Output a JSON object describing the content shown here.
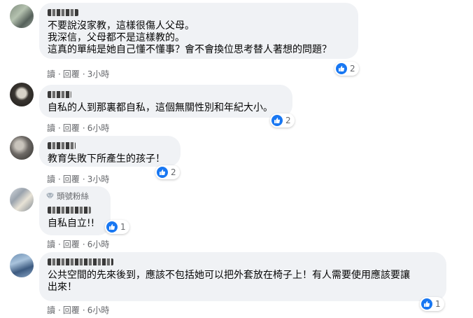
{
  "comments": [
    {
      "lines": [
        "不要說沒家教，這樣很傷人父母。",
        "我深信，父母都不是這樣教的。",
        "這真的單純是她自己懂不懂事？會不會換位思考替人著想的問題？"
      ],
      "reactions": "2",
      "actions": {
        "read": "讀",
        "reply": "回覆",
        "time": "3小時"
      }
    },
    {
      "lines": [
        "自私的人到那裏都自私，這個無關性別和年紀大小。"
      ],
      "reactions": "2",
      "actions": {
        "read": "讀",
        "reply": "回覆",
        "time": "6小時"
      }
    },
    {
      "lines": [
        "教育失敗下所產生的孩子！"
      ],
      "reactions": "2",
      "actions": {
        "read": "讀",
        "reply": "回覆",
        "time": "3小時"
      }
    },
    {
      "badge": "頭號粉絲",
      "lines": [
        "自私自立!!"
      ],
      "reactions": "1",
      "actions": {
        "read": "讀",
        "reply": "回覆",
        "time": "6小時"
      }
    },
    {
      "lines": [
        "公共空間的先來後到，應該不包括她可以把外套放在椅子上！有人需要使用應該要讓",
        "出來！"
      ],
      "reactions": "1",
      "actions": {
        "read": "讀",
        "reply": "回覆",
        "time": "6小時"
      }
    }
  ],
  "colors": {
    "like_blue": "#1877f2",
    "bubble_bg": "#f0f2f5",
    "meta_gray": "#65676b"
  },
  "icons": {
    "reaction": "like-icon",
    "badge": "top-fan-gem-icon"
  }
}
